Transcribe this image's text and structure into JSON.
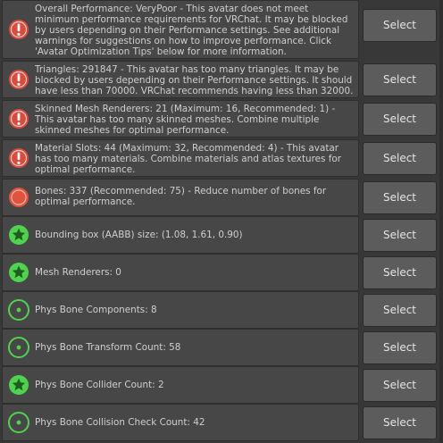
{
  "colors": {
    "error": "#d94b3f",
    "warning_bone": "#e0533e",
    "good": "#4fd34f"
  },
  "items": [
    {
      "icon": "error-icon",
      "text": "Overall Performance: VeryPoor - This avatar does not meet minimum performance requirements for VRChat. It may be blocked by users depending on their Performance settings. See additional warnings for suggestions on how to improve performance. Click 'Avatar Optimization Tips' below for more information.",
      "button": "Select"
    },
    {
      "icon": "error-icon",
      "text": "Triangles: 291847 - This avatar has too many triangles. It may be blocked by users depending on their Performance settings. It should have less than 70000. VRChat recommends having less than 32000.",
      "button": "Select"
    },
    {
      "icon": "error-icon",
      "text": "Skinned Mesh Renderers: 21 (Maximum: 16, Recommended: 1) - This avatar has too many skinned meshes. Combine multiple skinned meshes for optimal performance.",
      "button": "Select"
    },
    {
      "icon": "error-icon",
      "text": "Material Slots: 44 (Maximum: 32, Recommended: 4) - This avatar has too many materials. Combine materials and atlas textures for optimal performance.",
      "button": "Select"
    },
    {
      "icon": "warning-circle-icon",
      "text": "Bones: 337 (Recommended: 75) - Reduce number of bones for optimal performance.",
      "button": "Select"
    },
    {
      "icon": "star-icon",
      "text": "Bounding box (AABB) size: (1.08, 1.61, 0.90)",
      "button": "Select"
    },
    {
      "icon": "star-icon",
      "text": "Mesh Renderers: 0",
      "button": "Select"
    },
    {
      "icon": "dot-circle-icon",
      "text": "Phys Bone Components: 8",
      "button": "Select"
    },
    {
      "icon": "dot-circle-icon",
      "text": "Phys Bone Transform Count: 58",
      "button": "Select"
    },
    {
      "icon": "star-icon",
      "text": "Phys Bone Collider Count: 2",
      "button": "Select"
    },
    {
      "icon": "dot-circle-icon",
      "text": "Phys Bone Collision Check Count: 42",
      "button": "Select"
    }
  ]
}
